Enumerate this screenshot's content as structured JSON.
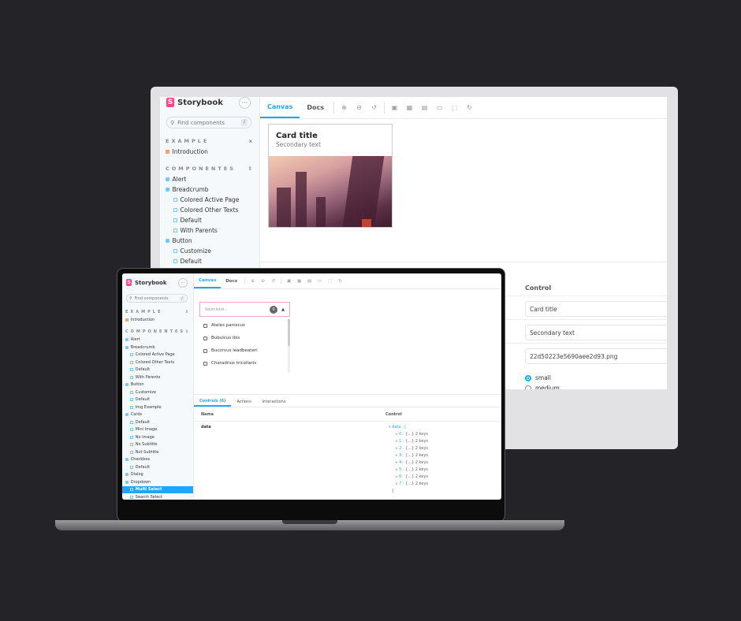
{
  "app": {
    "name": "Storybook",
    "logo_letter": "S",
    "more_icon": "ellipsis-icon"
  },
  "search": {
    "placeholder": "Find components",
    "shortcut": "/"
  },
  "colors": {
    "accent": "#1ea7fd",
    "brand": "#ff4785",
    "background": "#242327",
    "dropdown_border": "#f5a3c7"
  },
  "toolbar": {
    "tabs": [
      "Canvas",
      "Docs"
    ],
    "active_tab": "Canvas",
    "tools": [
      "zoom-in-icon",
      "zoom-out-icon",
      "zoom-reset-icon",
      "background-icon",
      "grid-icon",
      "viewport-icon",
      "measure-icon",
      "outline-icon",
      "refresh-icon"
    ]
  },
  "monitor": {
    "sidebar": {
      "sections": [
        {
          "title": "EXAMPLE",
          "toggle": "x",
          "items": [
            {
              "label": "Introduction",
              "type": "doc",
              "level": 0
            }
          ]
        },
        {
          "title": "COMPONENTES",
          "toggle": "⇕",
          "items": [
            {
              "label": "Alert",
              "type": "comp",
              "level": 0
            },
            {
              "label": "Breadcrumb",
              "type": "comp",
              "level": 0
            },
            {
              "label": "Colored Active Page",
              "type": "story",
              "level": 1
            },
            {
              "label": "Colored Other Texts",
              "type": "story",
              "level": 1
            },
            {
              "label": "Default",
              "type": "story",
              "level": 1
            },
            {
              "label": "With Parents",
              "type": "story",
              "level": 1
            },
            {
              "label": "Button",
              "type": "comp",
              "level": 0
            },
            {
              "label": "Customize",
              "type": "story",
              "level": 1
            },
            {
              "label": "Default",
              "type": "story",
              "level": 1
            }
          ]
        }
      ]
    },
    "card": {
      "title": "Card title",
      "subtitle": "Secondary text"
    },
    "controls": {
      "header": "Control",
      "fields": [
        "Card title",
        "Secondary text",
        "22d50223e5690aee2d93.png"
      ],
      "radio_options": [
        "small",
        "medium"
      ],
      "radio_selected": "small"
    }
  },
  "laptop": {
    "sidebar": {
      "sections": [
        {
          "title": "EXAMPLE",
          "toggle": "⇕",
          "items": [
            {
              "label": "Introduction",
              "type": "doc",
              "level": 0
            }
          ]
        },
        {
          "title": "COMPONENTES",
          "toggle": "⇕",
          "items": [
            {
              "label": "Alert",
              "type": "comp",
              "level": 0
            },
            {
              "label": "Breadcrumb",
              "type": "comp",
              "level": 0
            },
            {
              "label": "Colored Active Page",
              "type": "story",
              "level": 1
            },
            {
              "label": "Colored Other Texts",
              "type": "story",
              "level": 1
            },
            {
              "label": "Default",
              "type": "story",
              "level": 1
            },
            {
              "label": "With Parents",
              "type": "story",
              "level": 1
            },
            {
              "label": "Button",
              "type": "comp",
              "level": 0
            },
            {
              "label": "Customize",
              "type": "story",
              "level": 1
            },
            {
              "label": "Default",
              "type": "story",
              "level": 1
            },
            {
              "label": "Img Example",
              "type": "story",
              "level": 1
            },
            {
              "label": "Cards",
              "type": "comp",
              "level": 0
            },
            {
              "label": "Default",
              "type": "story",
              "level": 1
            },
            {
              "label": "Mini Image",
              "type": "story",
              "level": 1
            },
            {
              "label": "No Image",
              "type": "story",
              "level": 1
            },
            {
              "label": "No Subtitle",
              "type": "story",
              "level": 1
            },
            {
              "label": "Not Subtitle",
              "type": "story",
              "level": 1
            },
            {
              "label": "Checkbox",
              "type": "comp",
              "level": 0
            },
            {
              "label": "Default",
              "type": "story",
              "level": 1
            },
            {
              "label": "Dialog",
              "type": "comp",
              "level": 0
            },
            {
              "label": "Dropdown",
              "type": "comp",
              "level": 0
            },
            {
              "label": "Multi Select",
              "type": "story",
              "level": 1,
              "selected": true
            },
            {
              "label": "Search Select",
              "type": "story",
              "level": 1
            }
          ]
        }
      ]
    },
    "dropdown": {
      "placeholder": "Selecione...",
      "count": "0",
      "options": [
        "Ateles paniscus",
        "Bubulcus ibis",
        "Bucorvus leadbeateri",
        "Charadrius tricollaris"
      ]
    },
    "panel": {
      "tabs": [
        "Controls (6)",
        "Actions",
        "Interactions"
      ],
      "active_tab": "Controls (6)",
      "col_name": "Name",
      "col_control": "Control",
      "row_name": "data",
      "json_root": "data : [",
      "json_items": [
        "0 : {...} 2 keys",
        "1 : {...} 2 keys",
        "2 : {...} 2 keys",
        "3 : {...} 2 keys",
        "4 : {...} 2 keys",
        "5 : {...} 2 keys",
        "6 : {...} 2 keys",
        "7 : {...} 2 keys"
      ],
      "json_close": "]"
    }
  }
}
